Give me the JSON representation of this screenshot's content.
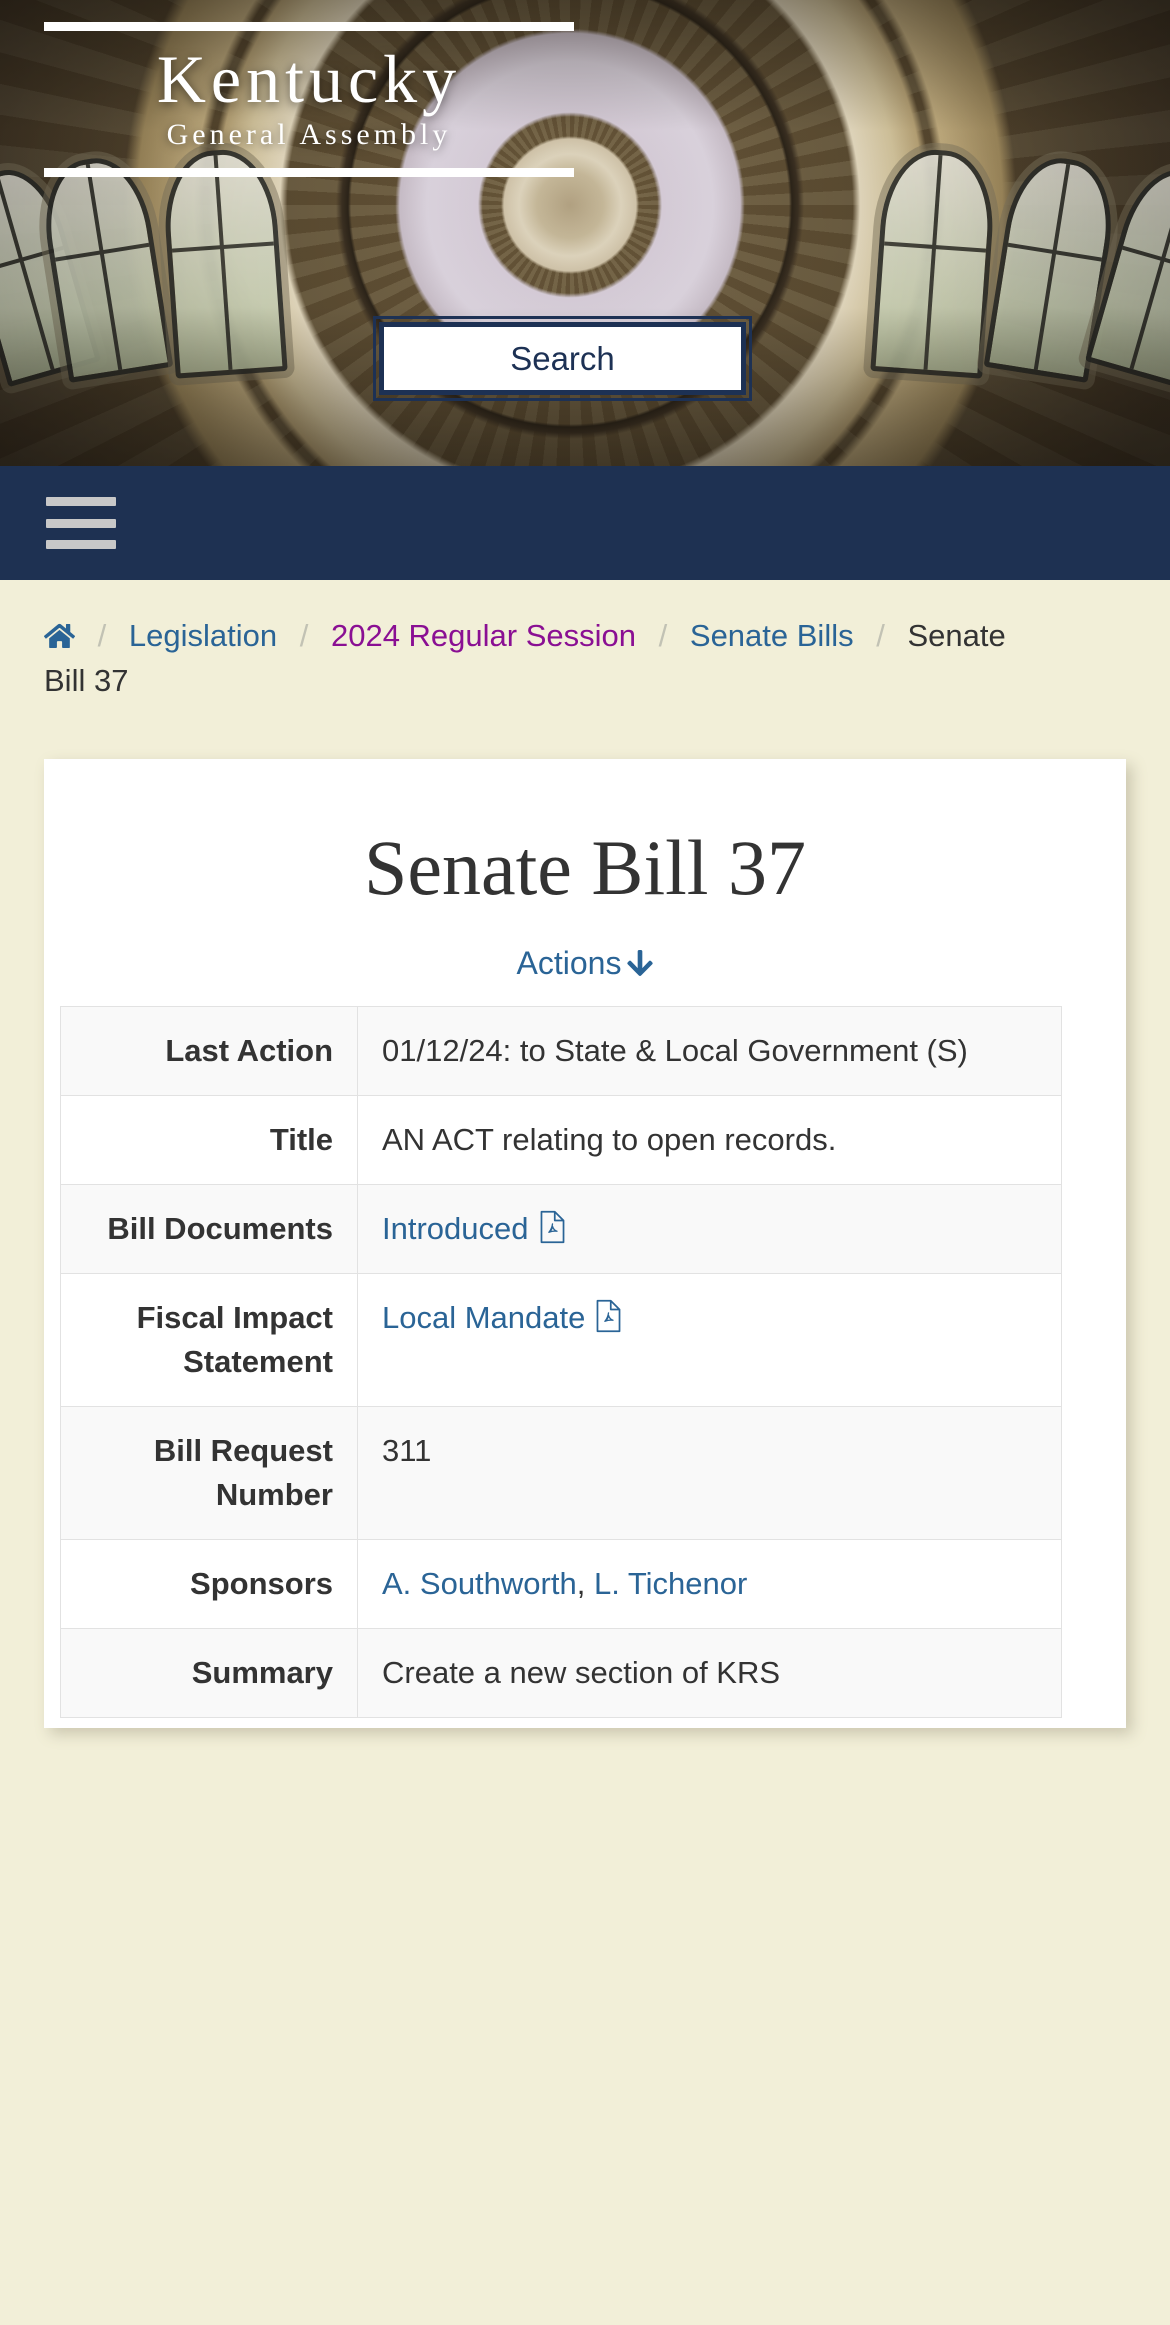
{
  "site": {
    "brand_name": "Kentucky",
    "brand_sub": "General Assembly",
    "search_label": "Search",
    "menu_icon": "hamburger-menu-icon"
  },
  "breadcrumb": {
    "home_icon": "home-icon",
    "separator": "/",
    "items": [
      {
        "label": "Legislation",
        "state": "link"
      },
      {
        "label": "2024 Regular Session",
        "state": "visited"
      },
      {
        "label": "Senate Bills",
        "state": "link"
      },
      {
        "label": "Senate Bill 37",
        "state": "current"
      }
    ]
  },
  "bill": {
    "title": "Senate Bill 37",
    "actions_label": "Actions",
    "actions_arrow_icon": "arrow-down-icon",
    "rows": [
      {
        "header": "Last Action",
        "value": "01/12/24: to State & Local Government (S)",
        "type": "text",
        "shaded": true
      },
      {
        "header": "Title",
        "value": "AN ACT relating to open records.",
        "type": "text",
        "shaded": false
      },
      {
        "header": "Bill Documents",
        "value": "Introduced",
        "type": "link-pdf",
        "shaded": true
      },
      {
        "header": "Fiscal Impact Statement",
        "value": "Local Mandate",
        "type": "link-pdf",
        "shaded": false
      },
      {
        "header": "Bill Request Number",
        "value": "311",
        "type": "text",
        "shaded": true
      },
      {
        "header": "Sponsors",
        "value": "A. Southworth, L. Tichenor",
        "type": "links",
        "sponsor_list": [
          "A. Southworth",
          "L. Tichenor"
        ],
        "shaded": false
      },
      {
        "header": "Summary",
        "value": "Create a new section of KRS",
        "type": "text",
        "shaded": true
      }
    ]
  },
  "colors": {
    "navy": "#1e3152",
    "link_blue": "#2a6496",
    "visited_purple": "#8a0f93",
    "page_bg": "#f2efd8",
    "card_bg": "#ffffff",
    "row_shade": "#f9f9f9"
  }
}
